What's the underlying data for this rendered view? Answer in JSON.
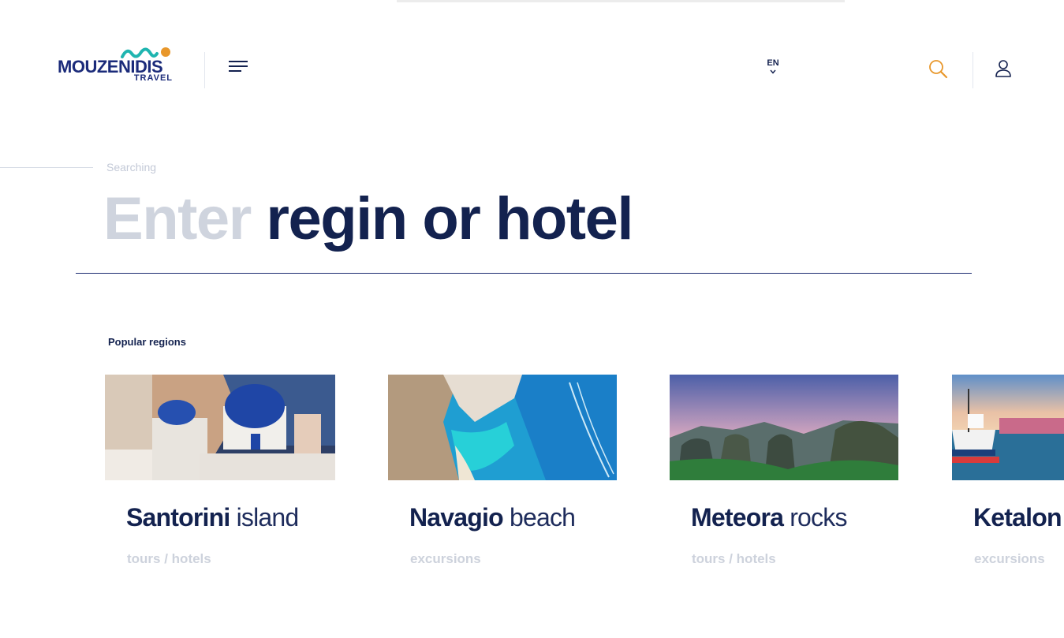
{
  "header": {
    "logo": {
      "name": "MOUZENIDIS",
      "sub": "TRAVEL"
    },
    "language": "EN"
  },
  "search": {
    "label": "Searching",
    "placeholder_light": "Enter",
    "placeholder_dark": "regin or hotel"
  },
  "popular": {
    "title": "Popular regions",
    "cards": [
      {
        "bold": "Santorini",
        "light": "island",
        "sub": "tours / hotels"
      },
      {
        "bold": "Navagio",
        "light": "beach",
        "sub": "excursions"
      },
      {
        "bold": "Meteora",
        "light": "rocks",
        "sub": "tours / hotels"
      },
      {
        "bold": "Ketalon",
        "light": "",
        "sub": "excursions"
      }
    ]
  },
  "colors": {
    "brand_navy": "#13224f",
    "accent_orange": "#e8972b",
    "logo_teal": "#1fb5b0",
    "muted": "#cfd4de"
  },
  "icons": {
    "menu": "hamburger-icon",
    "language_toggle": "chevron-down-icon",
    "search": "search-icon",
    "account": "user-icon"
  }
}
